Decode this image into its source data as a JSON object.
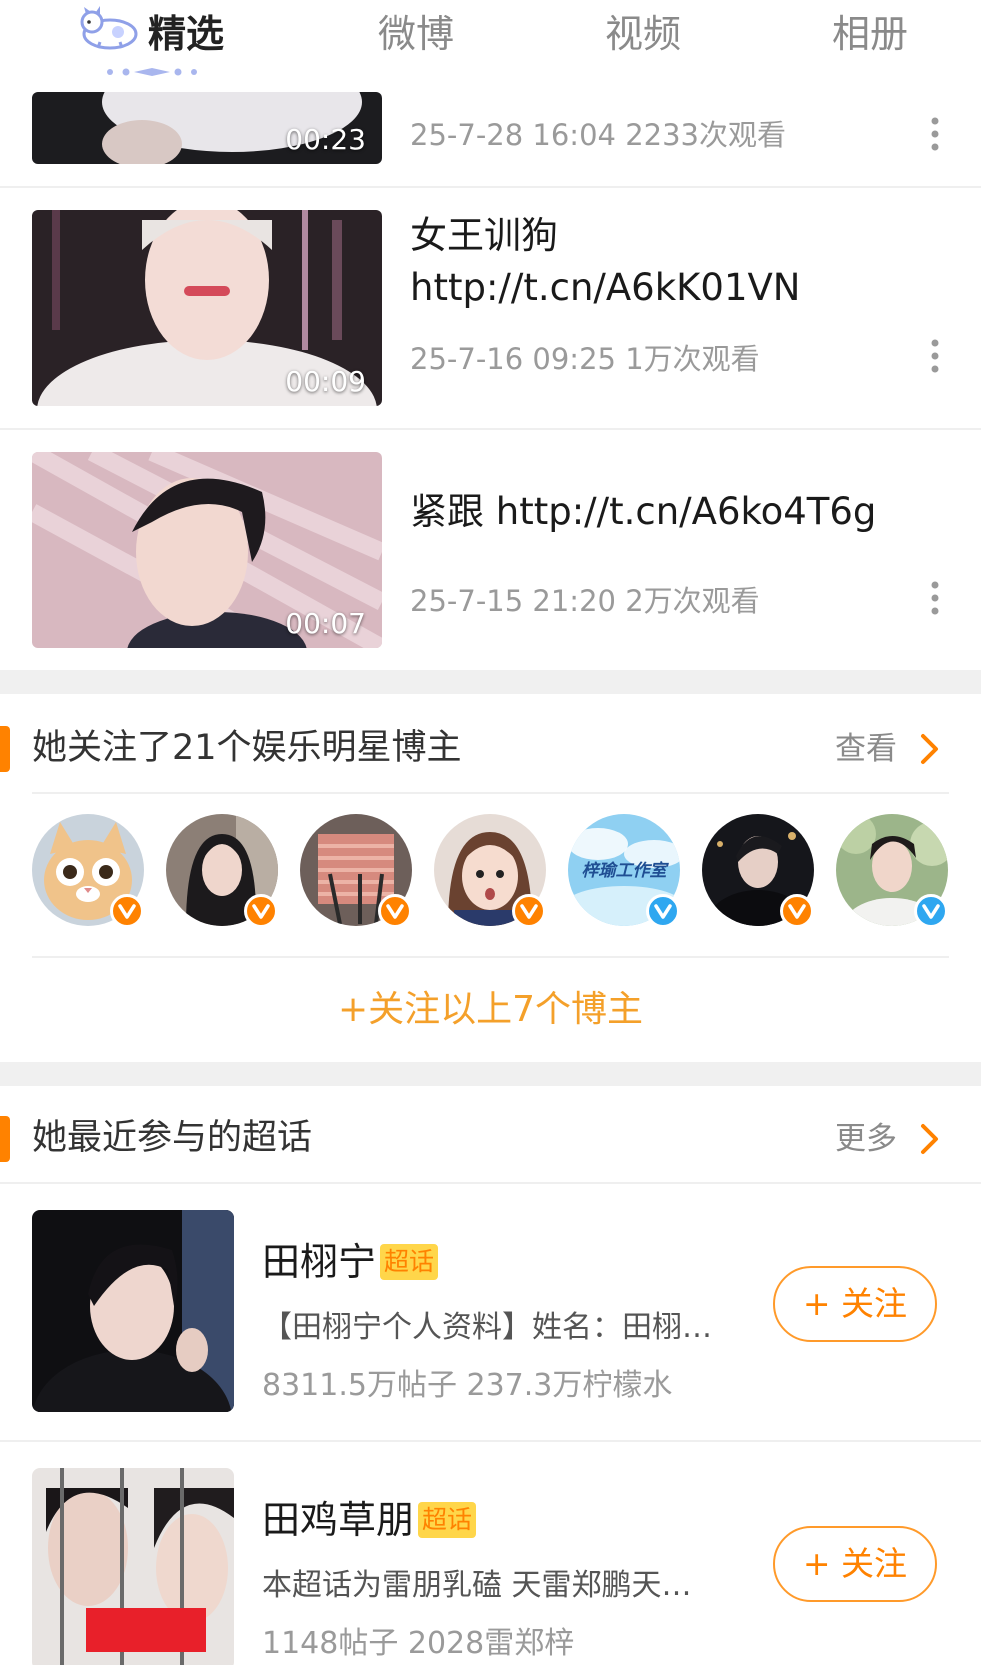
{
  "tabs": [
    {
      "label": "精选",
      "active": true
    },
    {
      "label": "微博",
      "active": false
    },
    {
      "label": "视频",
      "active": false
    },
    {
      "label": "相册",
      "active": false
    }
  ],
  "videos": [
    {
      "title": "",
      "duration": "00:23",
      "meta": "25-7-28 16:04 2233次观看"
    },
    {
      "title": "女王训狗 http://t.cn/A6kK01VN",
      "duration": "00:09",
      "meta": "25-7-16 09:25 1万次观看"
    },
    {
      "title": "紧跟 http://t.cn/A6ko4T6g",
      "duration": "00:07",
      "meta": "25-7-15 21:20 2万次观看"
    }
  ],
  "following_section": {
    "title": "她关注了21个娱乐明星博主",
    "link": "查看",
    "avatar_text": "梓瑜工作室",
    "follow_all": "+关注以上7个博主"
  },
  "topics_section": {
    "title": "她最近参与的超话",
    "link": "更多",
    "badge": "超话",
    "follow_label": "+ 关注",
    "topics": [
      {
        "name": "田栩宁",
        "desc": "【田栩宁个人资料】姓名：田栩…",
        "stats": "8311.5万帖子 237.3万柠檬水"
      },
      {
        "name": "田鸡草朋",
        "desc": "本超话为雷朋乳磕 天雷郑鹏天…",
        "stats": "1148帖子 2028雷郑梓"
      }
    ]
  },
  "colors": {
    "accent": "#ff8200",
    "vip_orange": "#ff8200",
    "verify_blue": "#2fa7f0",
    "follow_all": "#f4a02a"
  }
}
